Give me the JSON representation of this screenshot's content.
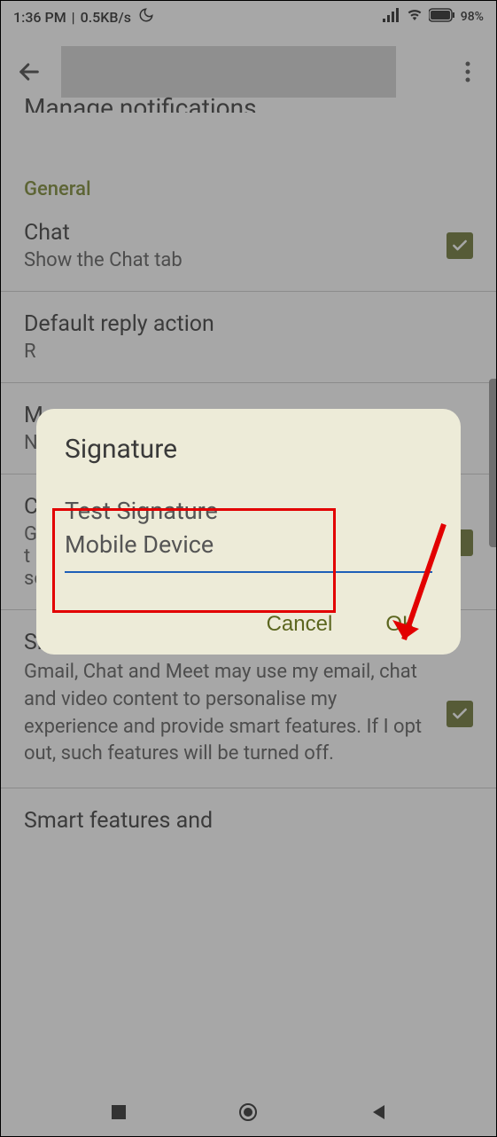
{
  "status": {
    "time": "1:36 PM",
    "speed": "0.5KB/s",
    "battery": "98%"
  },
  "page": {
    "truncatedHeader": "Manage notifications",
    "sectionLabel": "General"
  },
  "settings": {
    "chat": {
      "title": "Chat",
      "subtitle": "Show the Chat tab"
    },
    "reply": {
      "title": "Default reply action",
      "subtitle": "R"
    },
    "m": {
      "title": "M",
      "subtitle": "N"
    },
    "c": {
      "title": "C",
      "subtitle": "G\nt\nsome time to apply."
    },
    "smart": {
      "title": "Smart features and personalisation",
      "subtitle": "Gmail, Chat and Meet may use my email, chat and video content to personalise my experience and provide smart features. If I opt out, such features will be turned off."
    },
    "bottom": {
      "title": "Smart features and"
    }
  },
  "dialog": {
    "title": "Signature",
    "input": "Test Signature\nMobile Device",
    "cancel": "Cancel",
    "ok": "OK"
  }
}
